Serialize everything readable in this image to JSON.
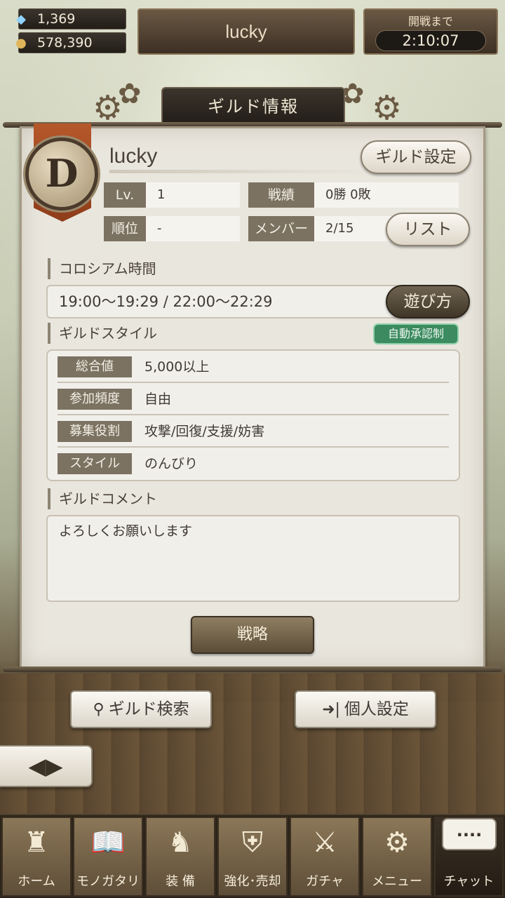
{
  "resources": {
    "gems": "1,369",
    "coins": "578,390"
  },
  "player_name": "lucky",
  "battle_timer": {
    "label": "開戦まで",
    "time": "2:10:07"
  },
  "panel": {
    "title": "ギルド情報",
    "guild_rank": "D",
    "guild_name": "lucky",
    "settings_button": "ギルド設定",
    "stats": {
      "level_label": "Lv.",
      "level_value": "1",
      "record_label": "戦績",
      "record_value": "0勝 0敗",
      "rank_label": "順位",
      "rank_value": "-",
      "member_label": "メンバー",
      "member_value": "2/15"
    },
    "list_button": "リスト",
    "colosseum": {
      "title": "コロシアム時間",
      "time": "19:00〜19:29 / 22:00〜22:29",
      "howto_button": "遊び方"
    },
    "guild_style": {
      "title": "ギルドスタイル",
      "auto_badge": "自動承認制",
      "rows": [
        {
          "label": "総合値",
          "value": "5,000以上"
        },
        {
          "label": "参加頻度",
          "value": "自由"
        },
        {
          "label": "募集役割",
          "value": "攻撃/回復/支援/妨害"
        },
        {
          "label": "スタイル",
          "value": "のんびり"
        }
      ]
    },
    "comment": {
      "title": "ギルドコメント",
      "text": "よろしくお願いします"
    },
    "strategy_button": "戦略"
  },
  "actions": {
    "guild_search": "ギルド検索",
    "personal_settings": "個人設定"
  },
  "nav": [
    {
      "label": "ホーム",
      "icon": "castle-icon"
    },
    {
      "label": "モノガタリ",
      "icon": "book-icon"
    },
    {
      "label": "装 備",
      "icon": "armor-icon"
    },
    {
      "label": "強化･売却",
      "icon": "mask-icon"
    },
    {
      "label": "ガチャ",
      "icon": "crossed-swords-icon"
    },
    {
      "label": "メニュー",
      "icon": "gears-icon"
    },
    {
      "label": "チャット",
      "icon": "chat-bubble-icon"
    }
  ],
  "chat_bubble_text": "....",
  "colors": {
    "panel_bg": "#e9e6de",
    "label_bg": "#7b7262",
    "badge_green": "#3b8a60",
    "ribbon_orange": "#b5582a"
  }
}
